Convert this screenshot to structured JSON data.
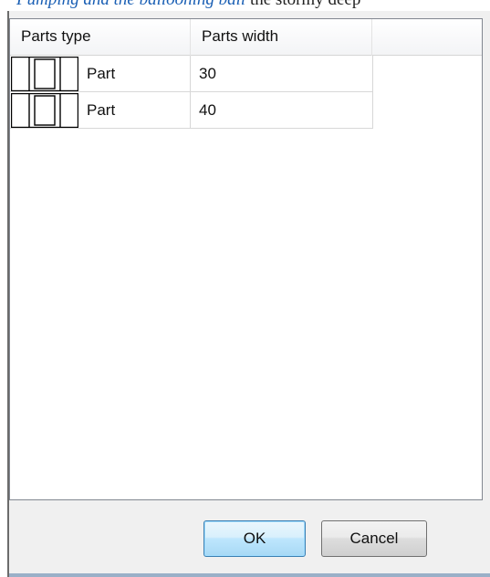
{
  "table": {
    "columns": [
      {
        "label": "Parts type"
      },
      {
        "label": "Parts width"
      },
      {
        "label": ""
      }
    ],
    "rows": [
      {
        "icon": "part-profile-icon",
        "type": "Part",
        "width": "30"
      },
      {
        "icon": "part-profile-icon",
        "type": "Part",
        "width": "40"
      }
    ]
  },
  "buttons": {
    "ok_label": "OK",
    "cancel_label": "Cancel"
  },
  "colors": {
    "dialog_background": "#f0f0f0",
    "list_background": "#ffffff",
    "ok_button_accent": "#3c7fb1"
  }
}
